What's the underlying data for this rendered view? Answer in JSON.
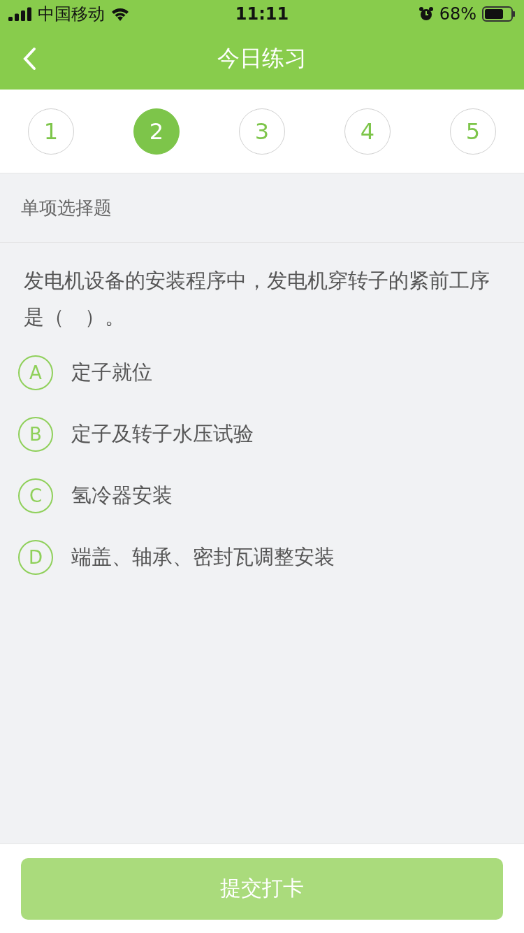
{
  "status_bar": {
    "carrier": "中国移动",
    "time": "11:11",
    "battery": "68%"
  },
  "nav": {
    "title": "今日练习"
  },
  "steps": [
    {
      "label": "1",
      "selected": false
    },
    {
      "label": "2",
      "selected": true
    },
    {
      "label": "3",
      "selected": false
    },
    {
      "label": "4",
      "selected": false
    },
    {
      "label": "5",
      "selected": false
    }
  ],
  "section": {
    "title": "单项选择题"
  },
  "question": {
    "text": "发电机设备的安装程序中，发电机穿转子的紧前工序是（　）。"
  },
  "options": [
    {
      "letter": "A",
      "text": "定子就位",
      "selected": false
    },
    {
      "letter": "B",
      "text": "定子及转子水压试验",
      "selected": false
    },
    {
      "letter": "C",
      "text": "氢冷器安装",
      "selected": false
    },
    {
      "letter": "D",
      "text": "端盖、轴承、密封瓦调整安装",
      "selected": false
    }
  ],
  "submit": {
    "label": "提交打卡",
    "disabled": true
  }
}
